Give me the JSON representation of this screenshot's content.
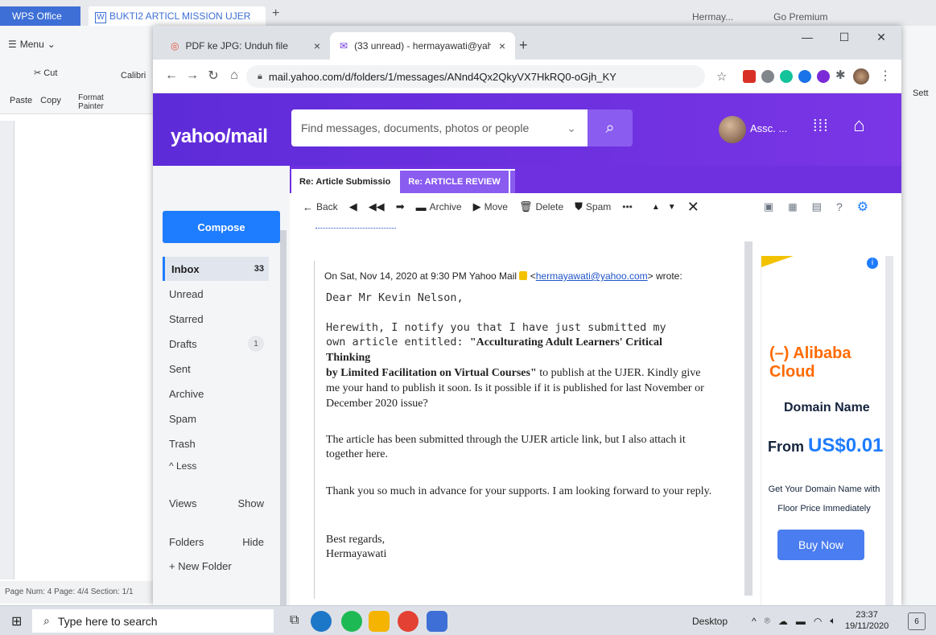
{
  "wps": {
    "office_tab": "WPS Office",
    "doc_tab": "BUKTI2 ARTICL MISSION UJER",
    "account": "Hermay...",
    "premium": "Go Premium",
    "menu": "Menu",
    "paste": "Paste",
    "cut": "Cut",
    "copy": "Copy",
    "format_painter": "Format Painter",
    "font": "Calibri",
    "status": "Page Num: 4   Page: 4/4   Section: 1/1",
    "sett": "Sett"
  },
  "browser": {
    "tab_inactive": "PDF ke JPG: Unduh file",
    "tab_active": "(33 unread) - hermayawati@yaho",
    "url": "mail.yahoo.com/d/folders/1/messages/ANnd4Qx2QkyVX7HkRQ0-oGjh_KY"
  },
  "yahoo": {
    "logo": "yahoo/mail",
    "search_placeholder": "Find messages, documents, photos or people",
    "user": "Assc. ...",
    "tabs": [
      "Re: Article Submissio",
      "Re: ARTICLE REVIEW"
    ],
    "compose": "Compose",
    "folders": [
      {
        "label": "Inbox",
        "count": "33"
      },
      {
        "label": "Unread"
      },
      {
        "label": "Starred"
      },
      {
        "label": "Drafts",
        "count": "1"
      },
      {
        "label": "Sent"
      },
      {
        "label": "Archive"
      },
      {
        "label": "Spam"
      },
      {
        "label": "Trash"
      },
      {
        "label": "^ Less"
      }
    ],
    "views": "Views",
    "views_action": "Show",
    "folders_label": "Folders",
    "folders_action": "Hide",
    "new_folder": "+ New Folder",
    "toolbar": {
      "back": "Back",
      "archive": "Archive",
      "move": "Move",
      "delete": "Delete",
      "spam": "Spam",
      "more": "•••"
    }
  },
  "message": {
    "quote_header_prefix": "On Sat, Nov 14, 2020 at 9:30 PM Yahoo Mail",
    "quote_email": "hermayawati@yahoo.com",
    "quote_header_suffix": "wrote:",
    "greeting": "Dear Mr Kevin Nelson,",
    "p1_mono_1": "Herewith, I notify you that I have just submitted my",
    "p1_mono_2": "own article entitled: ",
    "p1_bold_1": "\"Acculturating Adult Learners' Critical",
    "p1_bold_2": "Thinking",
    "p1_bold_3": "by Limited Facilitation on Virtual Courses\"",
    "p1_rest": " to publish at the UJER.  Kindly give me your hand to publish it soon. Is it possible if it is published for last November or December 2020 issue?",
    "p2": "The article has been submitted through the UJER article link, but I also attach it together here.",
    "p3": "Thank you so much in advance for your supports. I am looking forward to your reply.",
    "closing": "Best regards,",
    "signature": "Hermayawati"
  },
  "ad": {
    "logo": "Alibaba Cloud",
    "title": "Domain Name",
    "price_prefix": "From ",
    "price": "US$0.01",
    "sub_1": "Get Your Domain Name with",
    "sub_2": "Floor Price Immediately",
    "button": "Buy Now"
  },
  "taskbar": {
    "search": "Type here to search",
    "desktop": "Desktop",
    "time": "23:37",
    "date": "19/11/2020",
    "notifications": "6"
  },
  "colors": {
    "yahoo_purple": "#6f31e0",
    "compose_blue": "#1e7cff",
    "ad_orange": "#ff6a00"
  }
}
